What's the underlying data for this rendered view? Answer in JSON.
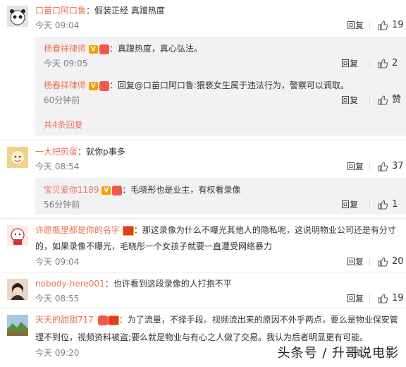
{
  "comments": [
    {
      "author": "口苗口阿口鲁",
      "text": "：假装正经 真蹭热度",
      "time": "今天 09:04",
      "reply": "回复",
      "likes": "19",
      "avatar_color": "#cfd6d0",
      "replies": [
        {
          "author": "杨春祥律师",
          "text": "：真蹭热度，真心弘法。",
          "time": "今天 09:05",
          "reply": "回复",
          "likes": "2"
        },
        {
          "author": "杨春祥律师",
          "text": "：回复@口苗口阿口鲁:猥亵女生属于违法行为，警察可以调取。",
          "time": "60分钟前",
          "reply": "回复",
          "likes": "赞"
        }
      ],
      "more": "共4条回复"
    },
    {
      "author": "一大把煎蛋",
      "text": "：就你p事多",
      "time": "今天 08:54",
      "reply": "回复",
      "likes": "37",
      "avatar_color": "#e6b25a",
      "replies": [
        {
          "author": "宝贝爱你1189",
          "text": "：毛晓彤也是业主，有权看录像",
          "time": "56分钟前",
          "reply": "回复",
          "likes": "1"
        }
      ]
    },
    {
      "author": "许愿瓶里都是你的名字",
      "text1": "：那这录像为什么不曝光其他人的隐私呢，这说明物业公司还是有分寸",
      "text2": "的，如果录像不曝光，毛晓彤一个女孩子就要一直遭受网络暴力",
      "time": "今天 09:04",
      "reply": "回复",
      "likes": "20",
      "avatar_color": "#b33a3a"
    },
    {
      "author": "nobody-here001",
      "text": "：也许看到这段录像的人打抱不平",
      "time": "今天 08:55",
      "reply": "回复",
      "likes": "19",
      "avatar_color": "#c9a98e"
    },
    {
      "author": "天天的甜甜717",
      "text1": "：为了流量，不择手段。视频流出来的原因不外乎两点，要么是物业保安管",
      "text2": "理不到位，视频资料被盗;要么就是物业与有心之人做了交易。我认为后者明显更有可能。",
      "time": "今天 09:20",
      "reply": "回复",
      "avatar_color": "#6f8f4c"
    }
  ],
  "watermark": "头条号 / 升哥说电影"
}
